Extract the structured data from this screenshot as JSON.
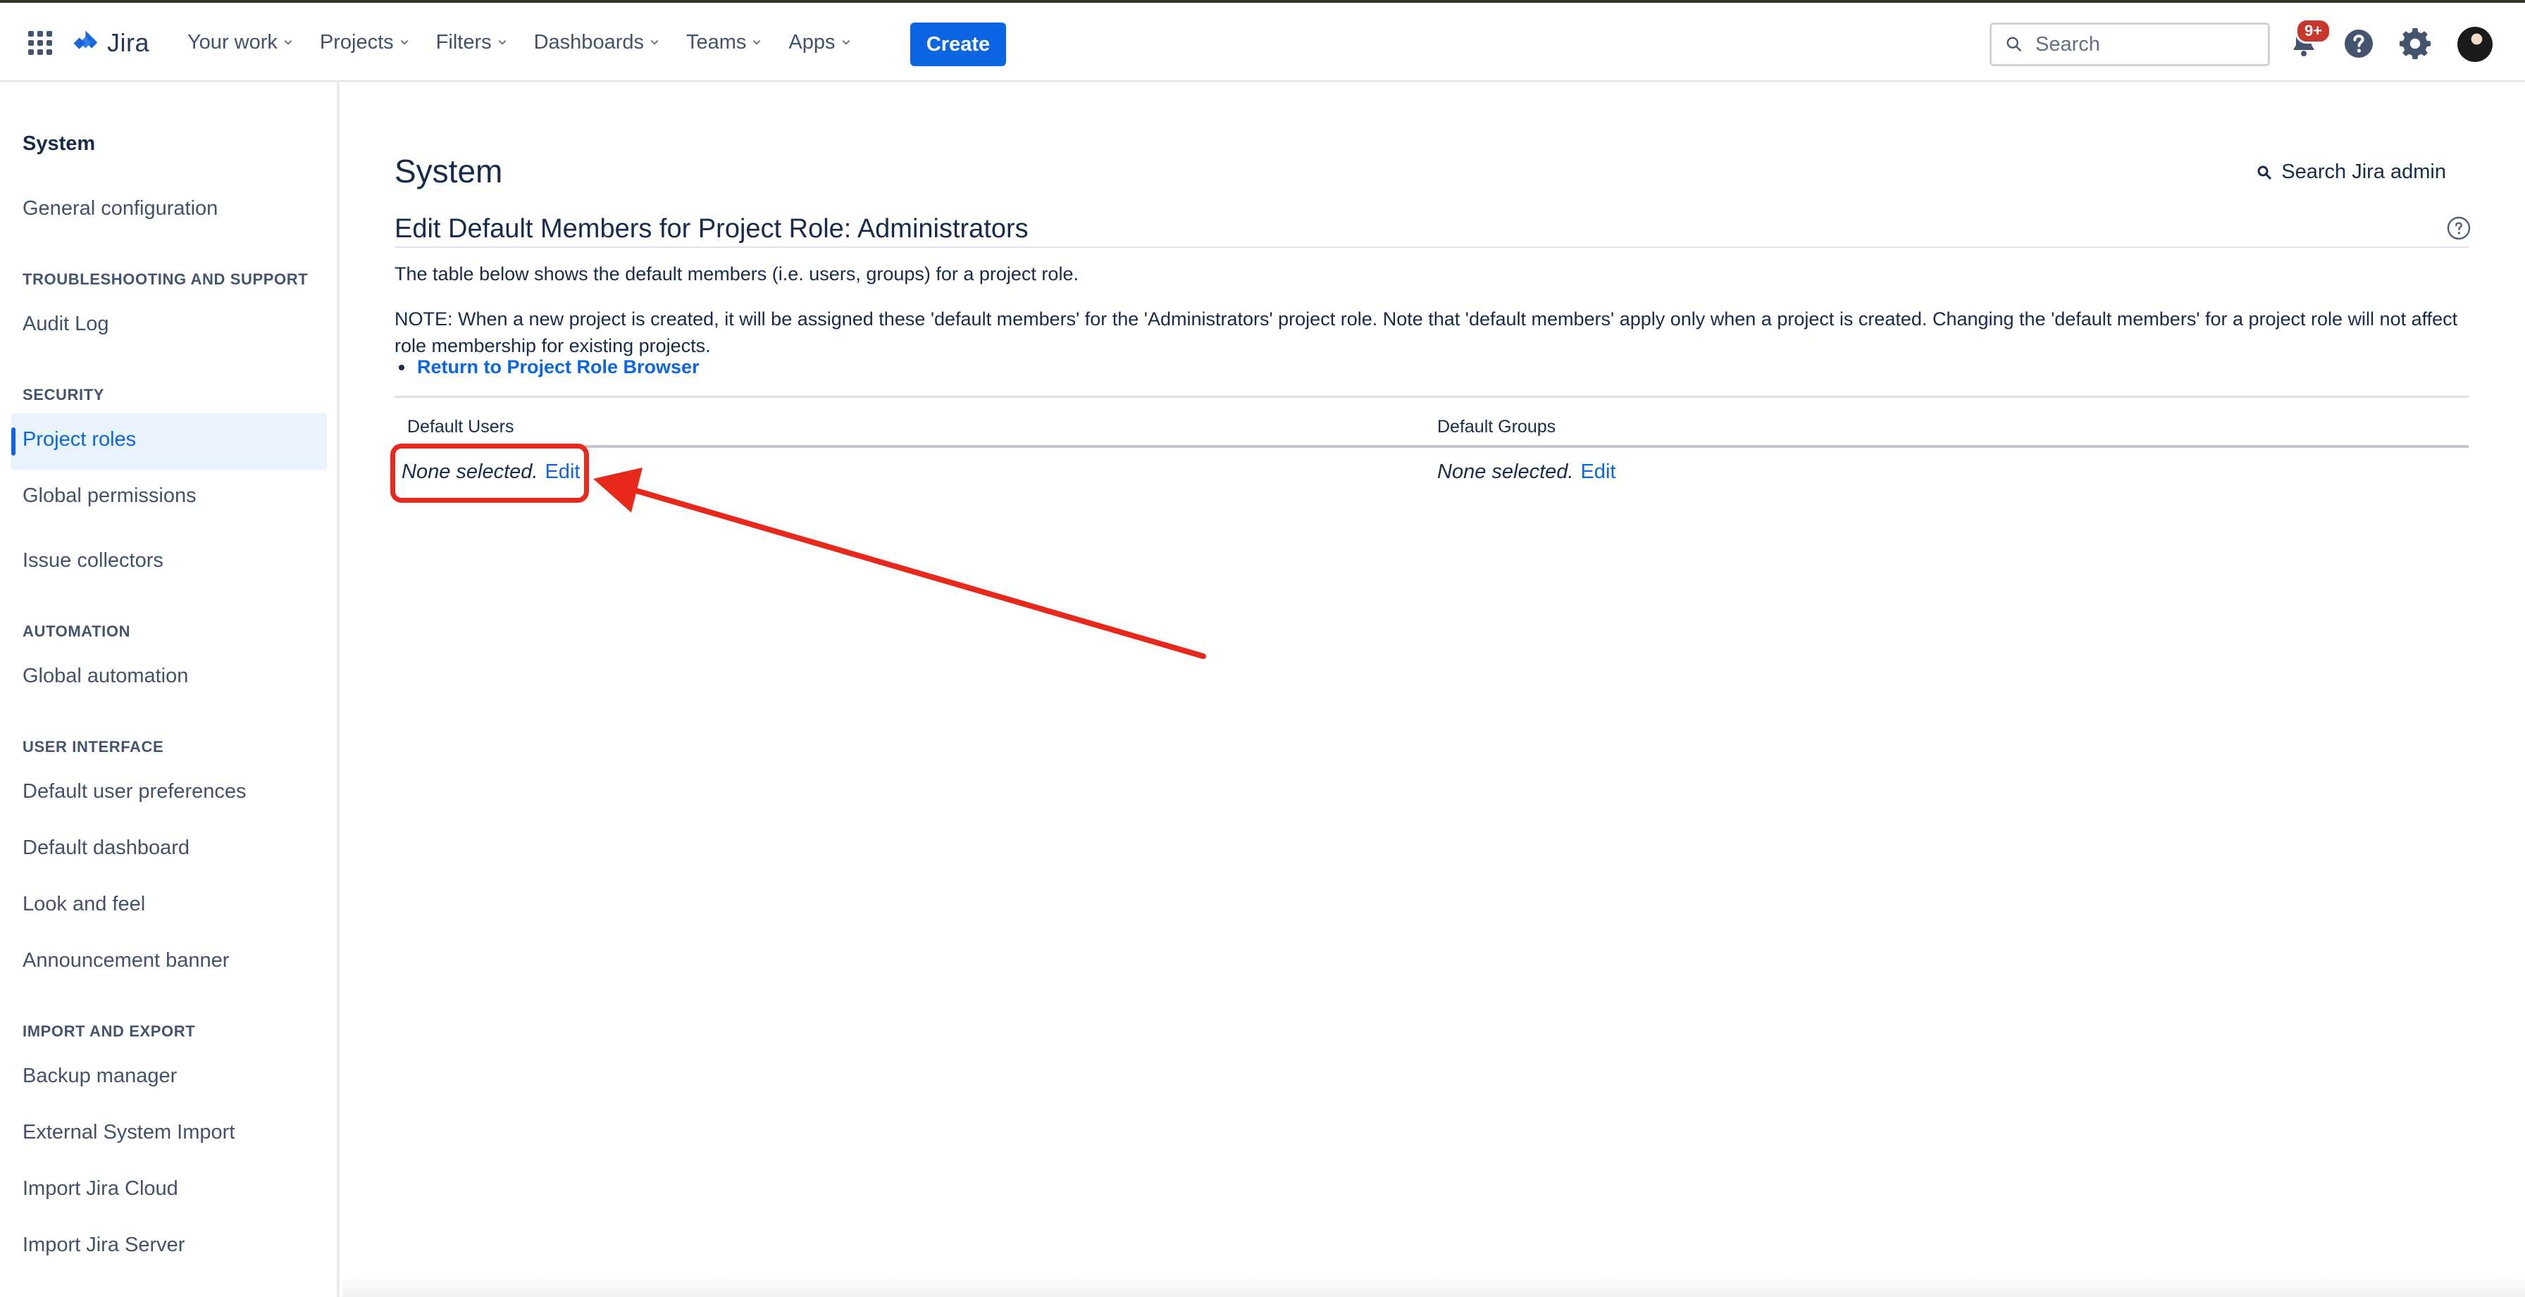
{
  "header": {
    "logo_text": "Jira",
    "nav": [
      {
        "label": "Your work"
      },
      {
        "label": "Projects"
      },
      {
        "label": "Filters"
      },
      {
        "label": "Dashboards"
      },
      {
        "label": "Teams"
      },
      {
        "label": "Apps"
      }
    ],
    "create_label": "Create",
    "search_placeholder": "Search",
    "notification_badge": "9+"
  },
  "sidebar": {
    "title": "System",
    "items": [
      {
        "type": "link",
        "label": "General configuration"
      },
      {
        "type": "heading",
        "label": "TROUBLESHOOTING AND SUPPORT"
      },
      {
        "type": "link",
        "label": "Audit Log"
      },
      {
        "type": "heading",
        "label": "SECURITY"
      },
      {
        "type": "link",
        "label": "Project roles",
        "active": true
      },
      {
        "type": "link",
        "label": "Global permissions"
      },
      {
        "type": "link",
        "label": "Issue collectors"
      },
      {
        "type": "heading",
        "label": "AUTOMATION"
      },
      {
        "type": "link",
        "label": "Global automation"
      },
      {
        "type": "heading",
        "label": "USER INTERFACE"
      },
      {
        "type": "link",
        "label": "Default user preferences"
      },
      {
        "type": "link",
        "label": "Default dashboard"
      },
      {
        "type": "link",
        "label": "Look and feel"
      },
      {
        "type": "link",
        "label": "Announcement banner"
      },
      {
        "type": "heading",
        "label": "IMPORT AND EXPORT"
      },
      {
        "type": "link",
        "label": "Backup manager"
      },
      {
        "type": "link",
        "label": "External System Import"
      },
      {
        "type": "link",
        "label": "Import Jira Cloud"
      },
      {
        "type": "link",
        "label": "Import Jira Server"
      }
    ]
  },
  "main": {
    "page_title": "System",
    "admin_search_label": "Search Jira admin",
    "section_title": "Edit Default Members for Project Role: Administrators",
    "description": "The table below shows the default members (i.e. users, groups) for a project role.",
    "note": "NOTE: When a new project is created, it will be assigned these 'default members' for the 'Administrators' project role. Note that 'default members' apply only when a project is created. Changing the 'default members' for a project role will not affect role membership for existing projects.",
    "back_link": "Return to Project Role Browser",
    "table": {
      "headers": [
        "Default Users",
        "Default Groups"
      ],
      "users_value": "None selected.",
      "groups_value": "None selected.",
      "edit_label": "Edit"
    }
  },
  "colors": {
    "accent": "#0c66e4",
    "annotation": "#e8281b",
    "badge": "#c9372c"
  }
}
